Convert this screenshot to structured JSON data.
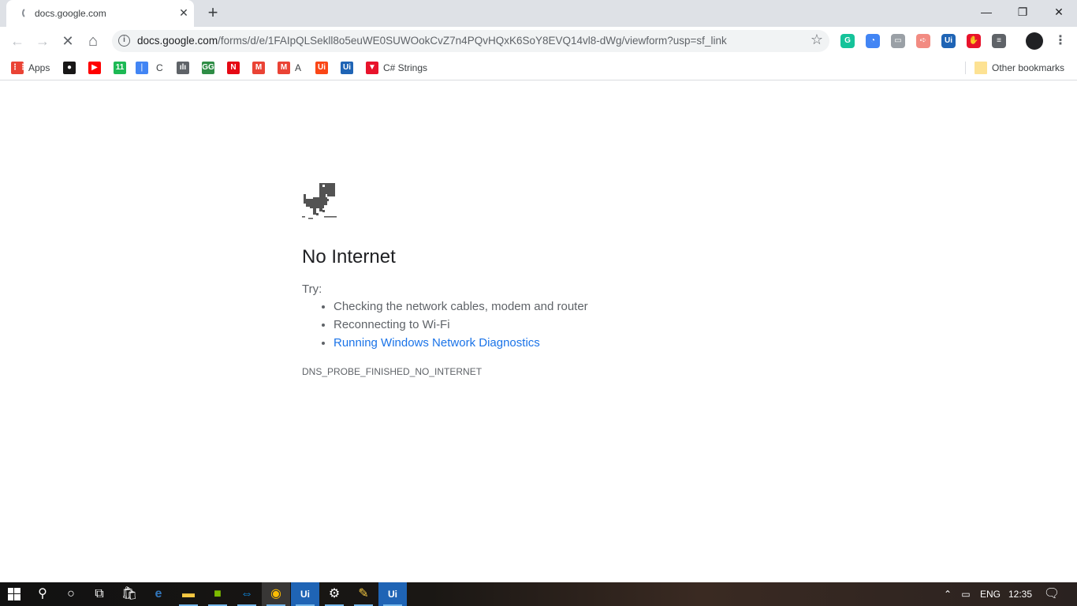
{
  "tab": {
    "title": "docs.google.com",
    "close": "✕"
  },
  "new_tab": "+",
  "window_controls": {
    "minimize": "—",
    "restore": "❐",
    "close": "✕"
  },
  "nav": {
    "back": "←",
    "forward": "→",
    "reload": "✕",
    "home": "⌂"
  },
  "omnibox": {
    "host": "docs.google.com",
    "path": "/forms/d/e/1FAIpQLSekll8o5euWE0SUWOokCvZ7n4PQvHQxK6SoY8EVQ14vl8-dWg/viewform?usp=sf_link",
    "info_icon": "i",
    "star": "☆"
  },
  "extensions": [
    {
      "name": "grammarly-icon",
      "label": "G",
      "color": "#15c39a"
    },
    {
      "name": "speed-dial-icon",
      "label": "◔",
      "color": "#4285f4"
    },
    {
      "name": "cast-icon",
      "label": "▭",
      "color": "#9aa0a6"
    },
    {
      "name": "pointer-icon",
      "label": "➪",
      "color": "#f28b82"
    },
    {
      "name": "uipath-icon",
      "label": "Ui",
      "color": "#1f64b5"
    },
    {
      "name": "adblock-icon",
      "label": "✋",
      "color": "#e8132b"
    },
    {
      "name": "media-icon",
      "label": "≡",
      "color": "#5f6368"
    }
  ],
  "bookmarks": [
    {
      "name": "bookmark-apps",
      "label": "Apps",
      "icon": "⋮⋮",
      "color": "#ea4335"
    },
    {
      "name": "bookmark-github",
      "label": "",
      "icon": "●",
      "color": "#181717"
    },
    {
      "name": "bookmark-youtube",
      "label": "",
      "icon": "▶",
      "color": "#ff0000"
    },
    {
      "name": "bookmark-11",
      "label": "",
      "icon": "11",
      "color": "#1db954"
    },
    {
      "name": "bookmark-feather",
      "label": "",
      "icon": "❘",
      "color": "#4285f4"
    },
    {
      "name": "bookmark-c",
      "label": "C",
      "icon": "",
      "color": ""
    },
    {
      "name": "bookmark-cisco",
      "label": "",
      "icon": "ılı",
      "color": "#5f6368"
    },
    {
      "name": "bookmark-gfg",
      "label": "",
      "icon": "GG",
      "color": "#2f8d46"
    },
    {
      "name": "bookmark-netflix",
      "label": "",
      "icon": "N",
      "color": "#e50914"
    },
    {
      "name": "bookmark-gmail",
      "label": "",
      "icon": "M",
      "color": "#ea4335"
    },
    {
      "name": "bookmark-gmail-a",
      "label": "A",
      "icon": "M",
      "color": "#ea4335"
    },
    {
      "name": "bookmark-ui-orange",
      "label": "",
      "icon": "Ui",
      "color": "#fa4616"
    },
    {
      "name": "bookmark-ui-blue",
      "label": "",
      "icon": "Ui",
      "color": "#1f64b5"
    },
    {
      "name": "bookmark-csharp",
      "label": "C# Strings",
      "icon": "▼",
      "color": "#e8132b"
    }
  ],
  "other_bookmarks": "Other bookmarks",
  "error": {
    "heading": "No Internet",
    "try": "Try:",
    "suggestions": [
      "Checking the network cables, modem and router",
      "Reconnecting to Wi-Fi"
    ],
    "diagnostics_link": "Running Windows Network Diagnostics",
    "code": "DNS_PROBE_FINISHED_NO_INTERNET"
  },
  "taskbar": {
    "language": "ENG",
    "time": "12:35"
  }
}
